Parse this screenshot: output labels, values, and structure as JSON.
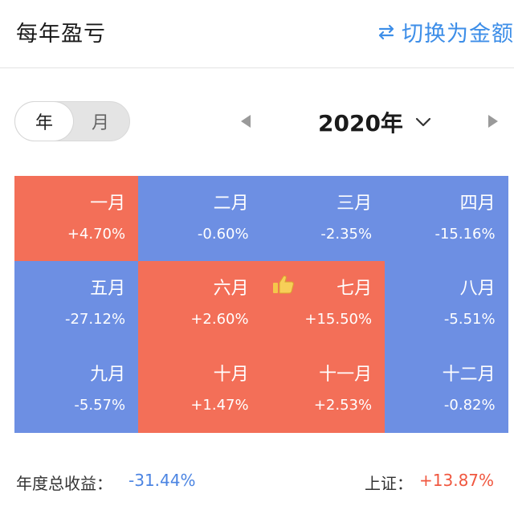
{
  "header": {
    "title": "每年盈亏",
    "switch_label": "切换为金额"
  },
  "toggle": {
    "year_label": "年",
    "month_label": "月",
    "selected": "年"
  },
  "year_selector": {
    "value": "2020年"
  },
  "colors": {
    "positive": "#f36f58",
    "negative": "#6d8fe3",
    "accent": "#3d8ee8",
    "text_positive": "#f0573f",
    "text_negative": "#4b84e2"
  },
  "months": [
    {
      "name": "一月",
      "value": "+4.70%",
      "trend": "up"
    },
    {
      "name": "二月",
      "value": "-0.60%",
      "trend": "down"
    },
    {
      "name": "三月",
      "value": "-2.35%",
      "trend": "down"
    },
    {
      "name": "四月",
      "value": "-15.16%",
      "trend": "down"
    },
    {
      "name": "五月",
      "value": "-27.12%",
      "trend": "down"
    },
    {
      "name": "六月",
      "value": "+2.60%",
      "trend": "up"
    },
    {
      "name": "七月",
      "value": "+15.50%",
      "trend": "up",
      "best": true,
      "icon": "thumbs-up-icon"
    },
    {
      "name": "八月",
      "value": "-5.51%",
      "trend": "down"
    },
    {
      "name": "九月",
      "value": "-5.57%",
      "trend": "down"
    },
    {
      "name": "十月",
      "value": "+1.47%",
      "trend": "up"
    },
    {
      "name": "十一月",
      "value": "+2.53%",
      "trend": "up"
    },
    {
      "name": "十二月",
      "value": "-0.82%",
      "trend": "down"
    }
  ],
  "footer": {
    "annual_label": "年度总收益：",
    "annual_value": "-31.44%",
    "index_label": "上证：",
    "index_value": "+13.87%"
  }
}
